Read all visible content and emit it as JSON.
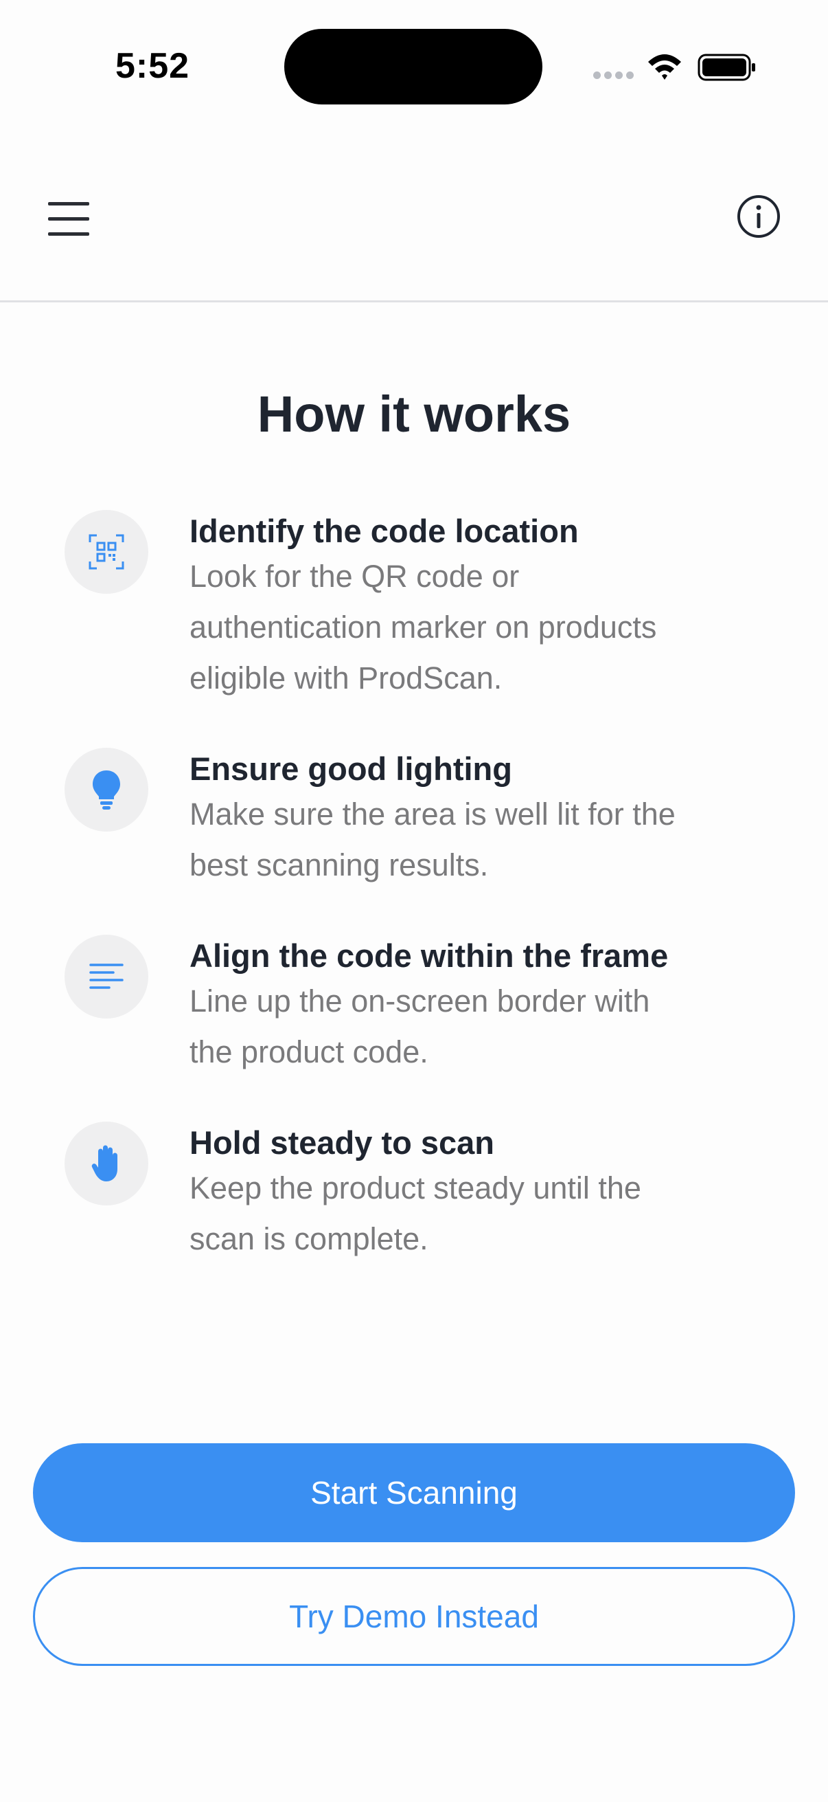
{
  "status_bar": {
    "time": "5:52"
  },
  "header": {
    "menu_icon": "hamburger-menu-icon",
    "info_icon": "info-circle-icon"
  },
  "main": {
    "title": "How it works",
    "steps": [
      {
        "icon": "qr-code-icon",
        "title": "Identify the code location",
        "desc_lines": [
          "Look for the QR code or",
          "authentication marker on products",
          "eligible with ProdScan."
        ]
      },
      {
        "icon": "lightbulb-icon",
        "title": "Ensure good lighting",
        "desc_lines": [
          "Make sure the area is well lit for the",
          "best scanning results."
        ]
      },
      {
        "icon": "align-left-icon",
        "title": "Align the code within the frame",
        "desc_lines": [
          "Line up the on-screen border with",
          "the product code."
        ]
      },
      {
        "icon": "hand-icon",
        "title": "Hold steady to scan",
        "desc_lines": [
          "Keep the product steady until the",
          "scan is complete."
        ]
      }
    ]
  },
  "actions": {
    "primary_label": "Start Scanning",
    "secondary_label": "Try Demo Instead"
  },
  "colors": {
    "accent": "#3a8ff2",
    "title": "#1f2530",
    "muted": "#7a7a7c",
    "icon_bg": "#efeff0"
  }
}
